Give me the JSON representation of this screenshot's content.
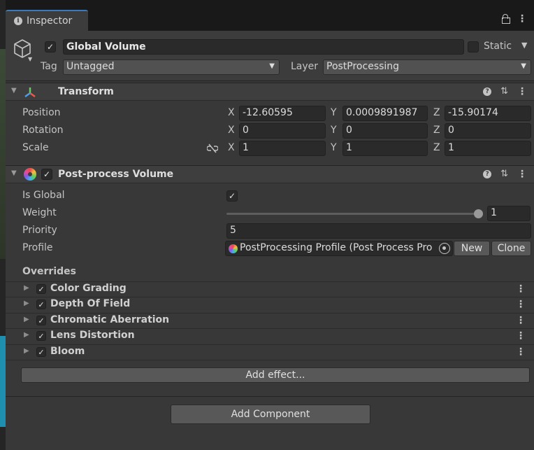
{
  "tab": {
    "title": "Inspector"
  },
  "object": {
    "name": "Global Volume",
    "active": true,
    "static_label": "Static",
    "static_checked": false,
    "tag_label": "Tag",
    "tag_value": "Untagged",
    "layer_label": "Layer",
    "layer_value": "PostProcessing"
  },
  "transform": {
    "title": "Transform",
    "position": {
      "label": "Position",
      "x": "-12.60595",
      "y": "0.0009891987",
      "z": "-15.90174"
    },
    "rotation": {
      "label": "Rotation",
      "x": "0",
      "y": "0",
      "z": "0"
    },
    "scale": {
      "label": "Scale",
      "x": "1",
      "y": "1",
      "z": "1"
    },
    "axes": {
      "x": "X",
      "y": "Y",
      "z": "Z"
    }
  },
  "ppv": {
    "title": "Post-process Volume",
    "enabled": true,
    "is_global": {
      "label": "Is Global",
      "checked": true
    },
    "weight": {
      "label": "Weight",
      "value": "1",
      "fraction": 1.0
    },
    "priority": {
      "label": "Priority",
      "value": "5"
    },
    "profile": {
      "label": "Profile",
      "value": "PostProcessing Profile (Post Process Pro",
      "new_label": "New",
      "clone_label": "Clone"
    },
    "overrides_title": "Overrides",
    "effects": [
      {
        "name": "Color Grading",
        "enabled": true
      },
      {
        "name": "Depth Of Field",
        "enabled": true
      },
      {
        "name": "Chromatic Aberration",
        "enabled": true
      },
      {
        "name": "Lens Distortion",
        "enabled": true
      },
      {
        "name": "Bloom",
        "enabled": true
      }
    ],
    "add_effect_label": "Add effect..."
  },
  "add_component_label": "Add Component",
  "colors": {
    "accent": "#3a79bb",
    "panel": "#383838",
    "field": "#2a2a2a"
  }
}
